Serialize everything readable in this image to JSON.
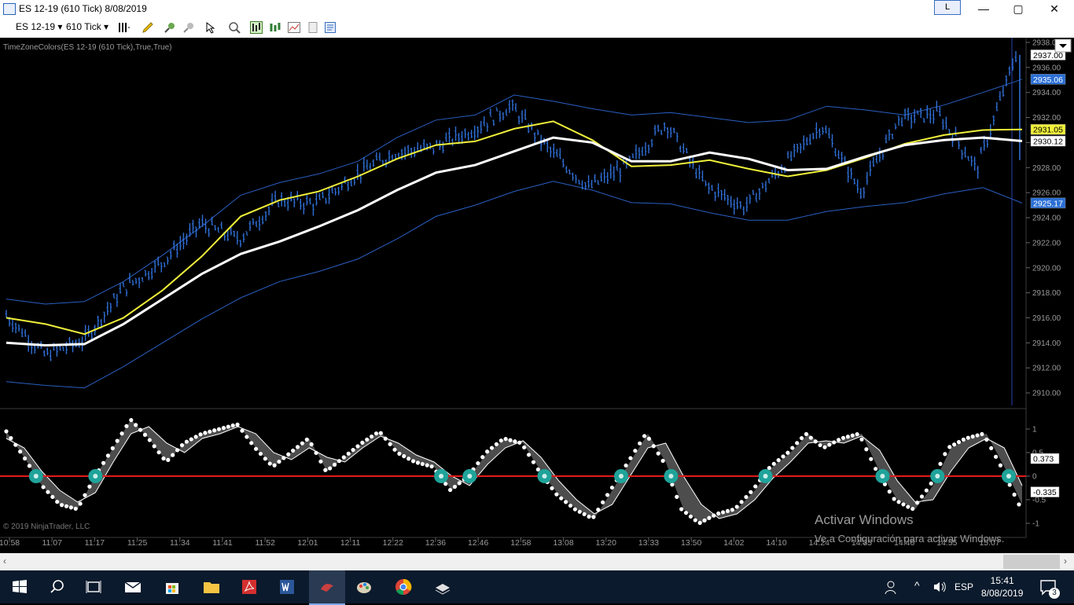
{
  "window": {
    "title": "ES 12-19 (610 Tick)  8/08/2019",
    "l_button": "L",
    "minimize": "—",
    "maximize": "▢",
    "close": "✕"
  },
  "toolbar": {
    "instrument": "ES 12-19",
    "interval": "610 Tick",
    "icons": [
      "bar-style-icon",
      "pencil-icon",
      "pin-icon",
      "crosshair-icon",
      "pointer-icon",
      "zoom-icon",
      "data-box-icon",
      "chart-trader-icon",
      "chart-style-icon",
      "properties-icon",
      "template-icon"
    ]
  },
  "chart_label": "TimeZoneColors(ES 12-19 (610 Tick),True,True)",
  "copyright": "© 2019 NinjaTrader, LLC",
  "watermark": {
    "line1": "Activar Windows",
    "line2": "Ve a Configuración para activar Windows."
  },
  "colors": {
    "price": "#2f6fd6",
    "ma_yellow": "#f0f03a",
    "ma_white": "#ffffff",
    "bands": "#2a5fc2",
    "zero_line": "#e21b1b",
    "osc_fill": "#5a5a5a",
    "markers": "#1fa39a"
  },
  "taskbar": {
    "lang": "ESP",
    "time": "15:41",
    "date": "8/08/2019",
    "notif_count": "3"
  },
  "chart_data": [
    {
      "type": "line",
      "title": "",
      "x": [
        "10:58",
        "11:07",
        "11:17",
        "11:25",
        "11:34",
        "11:41",
        "11:52",
        "12:01",
        "12:11",
        "12:22",
        "12:36",
        "12:46",
        "12:58",
        "13:08",
        "13:20",
        "13:33",
        "13:50",
        "14:02",
        "14:10",
        "14:24",
        "14:35",
        "14:46",
        "14:55",
        "15:07"
      ],
      "ylim": [
        2909,
        2938
      ],
      "y_ticks": [
        "2910.00",
        "2912.00",
        "2914.00",
        "2916.00",
        "2918.00",
        "2920.00",
        "2922.00",
        "2924.00",
        "2926.00",
        "2928.00",
        "2930.00",
        "2932.00",
        "2934.00",
        "2936.00",
        "2938.00"
      ],
      "series": [
        {
          "role": "price",
          "values": [
            2916.2,
            2913.0,
            2914.2,
            2918.3,
            2920.4,
            2923.5,
            2922.3,
            2925.4,
            2925.1,
            2927.4,
            2929.2,
            2929.6,
            2931.0,
            2932.9,
            2929.4,
            2926.4,
            2928.2,
            2931.6,
            2926.6,
            2924.8,
            2928.1,
            2931.4,
            2926.1,
            2931.9,
            2932.3,
            2927.9,
            2937.0
          ]
        },
        {
          "role": "ma_yellow",
          "values": [
            2916.0,
            2915.5,
            2914.7,
            2916.0,
            2918.2,
            2920.9,
            2924.1,
            2925.4,
            2926.1,
            2927.3,
            2928.7,
            2929.8,
            2930.1,
            2931.1,
            2931.7,
            2930.2,
            2928.1,
            2928.2,
            2928.6,
            2927.9,
            2927.3,
            2927.8,
            2928.8,
            2929.9,
            2930.6,
            2931.0,
            2931.05
          ]
        },
        {
          "role": "ma_white",
          "values": [
            2914.0,
            2913.8,
            2913.9,
            2915.5,
            2917.5,
            2919.5,
            2921.1,
            2922.1,
            2923.3,
            2924.6,
            2926.2,
            2927.6,
            2928.2,
            2929.3,
            2930.4,
            2930.0,
            2928.5,
            2928.5,
            2929.2,
            2928.7,
            2927.8,
            2927.9,
            2928.9,
            2929.8,
            2930.2,
            2930.4,
            2930.12
          ]
        },
        {
          "role": "upper_band",
          "values": [
            2917.5,
            2917.1,
            2917.3,
            2918.9,
            2921.0,
            2923.3,
            2925.8,
            2926.8,
            2927.5,
            2928.5,
            2930.4,
            2931.8,
            2932.2,
            2933.8,
            2933.3,
            2932.7,
            2932.2,
            2932.4,
            2932.0,
            2931.6,
            2931.8,
            2932.9,
            2932.6,
            2932.2,
            2933.0,
            2934.0,
            2935.06
          ]
        },
        {
          "role": "lower_band",
          "values": [
            2910.9,
            2910.6,
            2910.4,
            2912.1,
            2914.0,
            2915.9,
            2917.6,
            2918.9,
            2919.7,
            2920.7,
            2922.3,
            2924.1,
            2925.0,
            2926.1,
            2926.9,
            2926.2,
            2925.2,
            2925.1,
            2924.4,
            2923.8,
            2923.8,
            2924.5,
            2924.9,
            2925.2,
            2925.9,
            2926.4,
            2925.17
          ]
        }
      ],
      "price_labels": [
        {
          "value": 2937.0,
          "text": "2937.00",
          "style": "white"
        },
        {
          "value": 2935.06,
          "text": "2935.06",
          "style": "blue"
        },
        {
          "value": 2931.05,
          "text": "2931.05",
          "style": "yellow"
        },
        {
          "value": 2930.12,
          "text": "2930.12",
          "style": "white"
        },
        {
          "value": 2925.17,
          "text": "2925.17",
          "style": "blue"
        }
      ]
    },
    {
      "type": "line",
      "title": "",
      "ylim": [
        -1.2,
        1.2
      ],
      "y_ticks": [
        "-1",
        "-0.5",
        "0",
        "0.5",
        "1"
      ],
      "series": [
        {
          "role": "oscillator",
          "values": [
            0.95,
            0.4,
            -0.2,
            -0.6,
            -0.7,
            0.0,
            0.6,
            1.2,
            0.8,
            0.3,
            0.7,
            0.9,
            1.0,
            1.1,
            0.6,
            0.2,
            0.5,
            0.8,
            0.1,
            0.4,
            0.7,
            0.95,
            0.5,
            0.3,
            0.2,
            -0.3,
            0.0,
            0.5,
            0.8,
            0.7,
            0.1,
            -0.4,
            -0.7,
            -0.9,
            -0.3,
            0.3,
            0.9,
            0.3,
            -0.7,
            -1.0,
            -0.8,
            -0.7,
            -0.3,
            0.2,
            0.5,
            0.9,
            0.6,
            0.8,
            0.9,
            0.1,
            -0.5,
            -0.7,
            -0.2,
            0.6,
            0.8,
            0.9,
            0.2,
            -0.6
          ]
        },
        {
          "role": "signal",
          "values": [
            0.8,
            0.6,
            0.1,
            -0.3,
            -0.55,
            -0.35,
            0.3,
            0.9,
            1.05,
            0.7,
            0.5,
            0.8,
            0.9,
            1.05,
            0.9,
            0.5,
            0.35,
            0.6,
            0.4,
            0.3,
            0.6,
            0.85,
            0.7,
            0.45,
            0.3,
            0.0,
            -0.2,
            0.25,
            0.6,
            0.75,
            0.4,
            -0.1,
            -0.5,
            -0.8,
            -0.6,
            0.0,
            0.6,
            0.7,
            0.0,
            -0.6,
            -0.9,
            -0.8,
            -0.5,
            -0.05,
            0.3,
            0.7,
            0.75,
            0.7,
            0.85,
            0.55,
            -0.1,
            -0.55,
            -0.5,
            0.1,
            0.6,
            0.8,
            0.6,
            -0.2
          ]
        }
      ],
      "value_labels": [
        {
          "value": 0.373,
          "text": "0.373"
        },
        {
          "value": -0.335,
          "text": "-0.335"
        }
      ]
    }
  ]
}
